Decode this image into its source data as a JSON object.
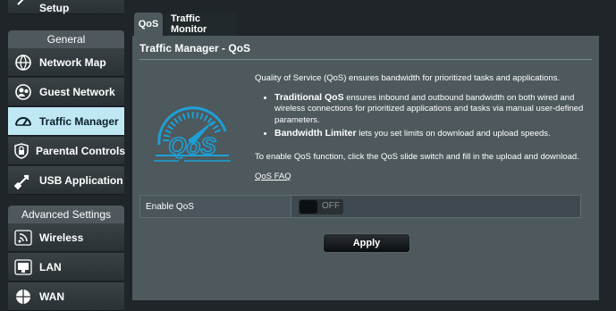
{
  "sidebar": {
    "partial_top_label": "Setup",
    "general_heading": "General",
    "general_items": [
      {
        "label": "Network Map",
        "icon": "globe-icon",
        "active": false
      },
      {
        "label": "Guest Network",
        "icon": "guest-network-icon",
        "active": false
      },
      {
        "label": "Traffic Manager",
        "icon": "speedometer-icon",
        "active": true
      },
      {
        "label": "Parental Controls",
        "icon": "lock-icon",
        "active": false
      },
      {
        "label": "USB Application",
        "icon": "usb-icon",
        "active": false
      }
    ],
    "advanced_heading": "Advanced Settings",
    "advanced_items": [
      {
        "label": "Wireless",
        "icon": "wifi-icon"
      },
      {
        "label": "LAN",
        "icon": "monitor-icon"
      },
      {
        "label": "WAN",
        "icon": "globe-icon"
      }
    ]
  },
  "tabs": [
    {
      "label": "QoS",
      "active": true
    },
    {
      "label": "Traffic Monitor",
      "active": false
    }
  ],
  "panel": {
    "title": "Traffic Manager - QoS",
    "intro": "Quality of Service (QoS) ensures bandwidth for prioritized tasks and applications.",
    "bullets": [
      {
        "bold": "Traditional QoS",
        "text": " ensures inbound and outbound bandwidth on both wired and wireless connections for prioritized applications and tasks via manual user-defined parameters."
      },
      {
        "bold": "Bandwidth Limiter",
        "text": " lets you set limits on download and upload speeds."
      }
    ],
    "enable_instructions": "To enable QoS function, click the QoS slide switch and fill in the upload and download.",
    "faq_link": "QoS FAQ",
    "logo_text": "QoS",
    "enable_label": "Enable QoS",
    "toggle_state": "OFF",
    "apply_label": "Apply"
  },
  "colors": {
    "panel_bg": "#4d595d",
    "active_menu": "#bfe8f4",
    "logo_blue": "#1e9fd6"
  }
}
